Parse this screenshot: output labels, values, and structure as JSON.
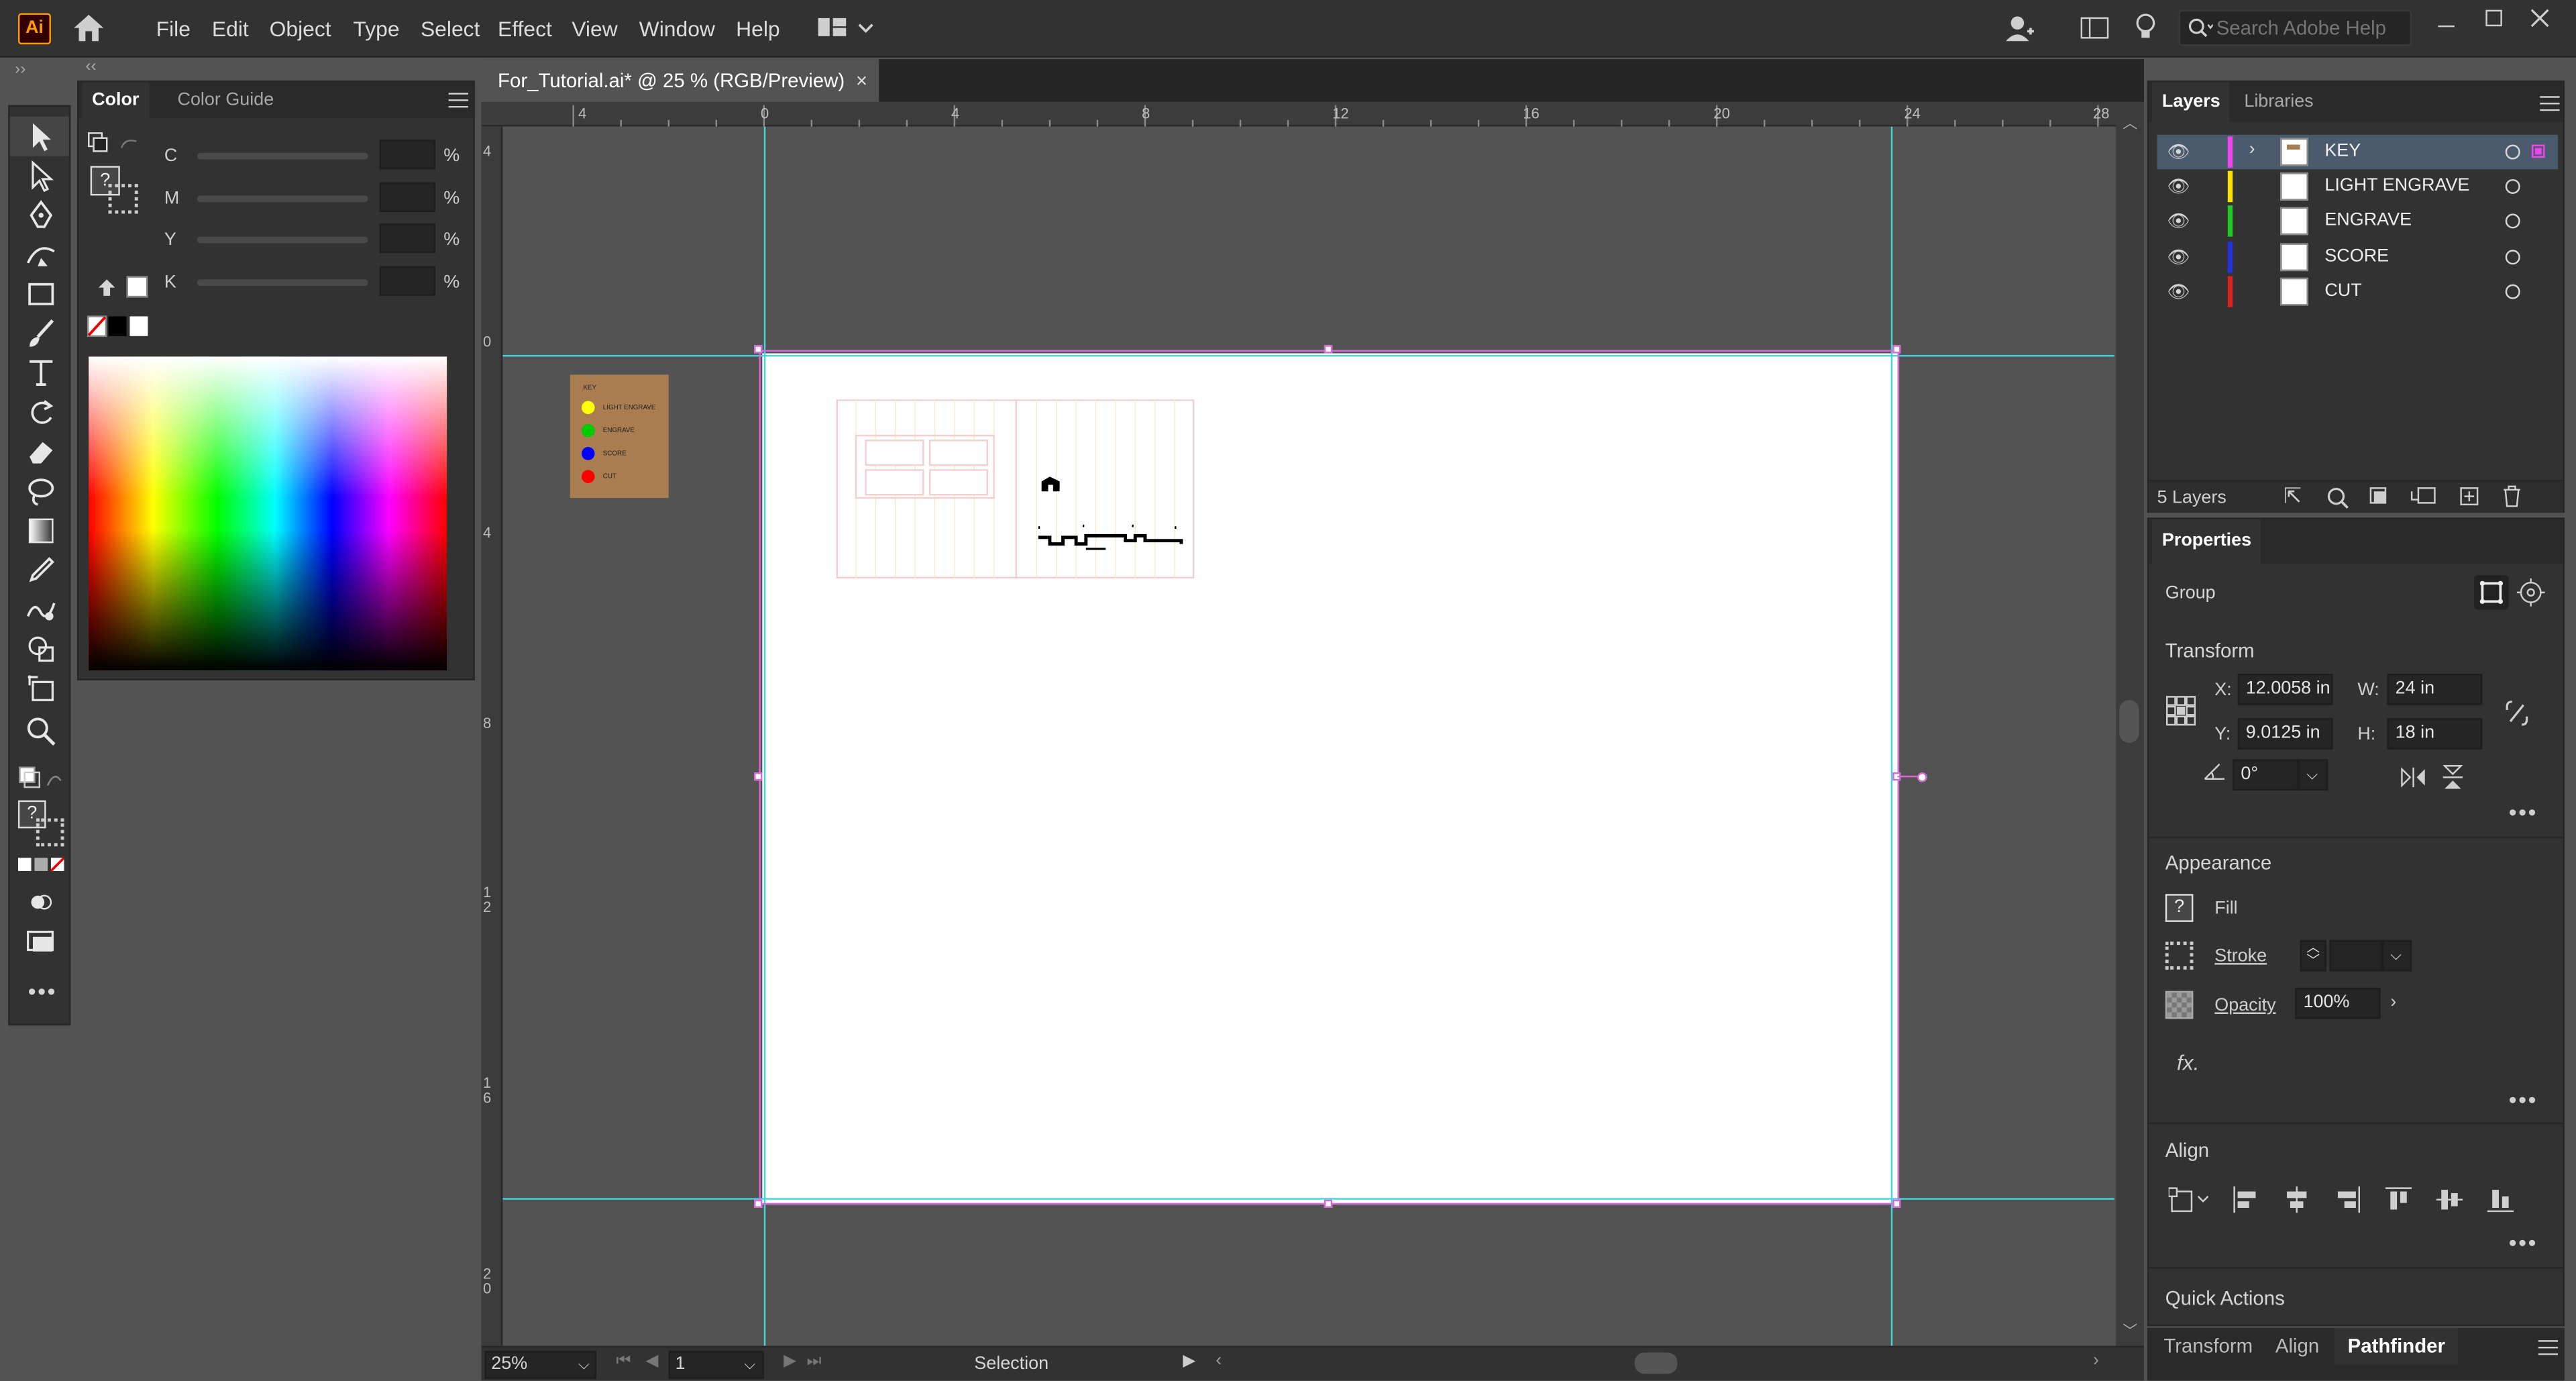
{
  "app": {
    "logo": "Ai",
    "accent": "#ff9a00"
  },
  "menu": [
    "File",
    "Edit",
    "Object",
    "Type",
    "Select",
    "Effect",
    "View",
    "Window",
    "Help"
  ],
  "search": {
    "placeholder": "Search Adobe Help"
  },
  "color_panel": {
    "tabs": [
      "Color",
      "Color Guide"
    ],
    "channels": [
      {
        "label": "C",
        "unit": "%"
      },
      {
        "label": "M",
        "unit": "%"
      },
      {
        "label": "Y",
        "unit": "%"
      },
      {
        "label": "K",
        "unit": "%"
      }
    ],
    "none_swatch": "?"
  },
  "document": {
    "tab_title": "For_Tutorial.ai* @ 25 % (RGB/Preview)",
    "close": "×",
    "ruler_top": [
      "4",
      "0",
      "4",
      "8",
      "12",
      "16",
      "20",
      "24",
      "28"
    ],
    "ruler_left": [
      "4",
      "0",
      "4",
      "8",
      "1 2",
      "1 6",
      "2 0"
    ],
    "key_card": {
      "title": "KEY",
      "items": [
        {
          "label": "LIGHT ENGRAVE",
          "color": "#ffff00"
        },
        {
          "label": "ENGRAVE",
          "color": "#00cc00"
        },
        {
          "label": "SCORE",
          "color": "#0000ff"
        },
        {
          "label": "CUT",
          "color": "#ff0000"
        }
      ]
    }
  },
  "status": {
    "zoom": "25%",
    "artboard": "1",
    "tool": "Selection"
  },
  "layers": {
    "tabs": [
      "Layers",
      "Libraries"
    ],
    "items": [
      {
        "name": "KEY",
        "color": "#ee44ee",
        "selected": true
      },
      {
        "name": "LIGHT ENGRAVE",
        "color": "#ffe000",
        "selected": false
      },
      {
        "name": "ENGRAVE",
        "color": "#22cc22",
        "selected": false
      },
      {
        "name": "SCORE",
        "color": "#2233dd",
        "selected": false
      },
      {
        "name": "CUT",
        "color": "#dd2222",
        "selected": false
      }
    ],
    "count": "5 Layers"
  },
  "properties": {
    "tab": "Properties",
    "object_type": "Group",
    "transform_title": "Transform",
    "x_label": "X:",
    "x": "12.0058 in",
    "y_label": "Y:",
    "y": "9.0125 in",
    "w_label": "W:",
    "w": "24 in",
    "h_label": "H:",
    "h": "18 in",
    "angle": "0°",
    "appearance_title": "Appearance",
    "fill_label": "Fill",
    "stroke_label": "Stroke",
    "opacity_label": "Opacity",
    "opacity": "100%",
    "fx": "fx.",
    "align_title": "Align",
    "quick_actions": "Quick Actions"
  },
  "bottom_tabs": [
    "Transform",
    "Align",
    "Pathfinder"
  ]
}
